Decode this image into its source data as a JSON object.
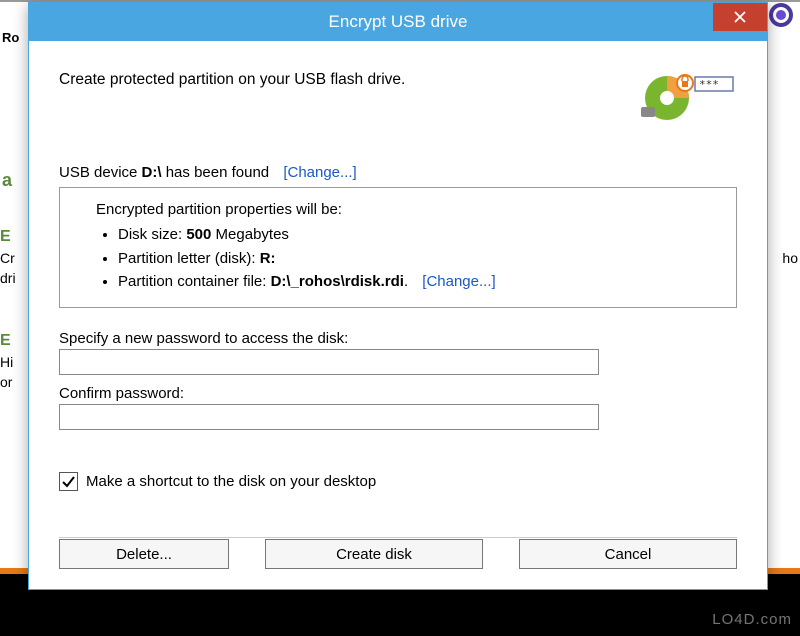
{
  "background": {
    "ro_label": "Ro",
    "left_text_partial_1": "E",
    "left_text_partial_2": "Cr",
    "left_text_partial_3": "dri",
    "left_text_partial_4": "E",
    "left_text_partial_5": "Hi",
    "left_text_partial_6": "or",
    "right_text_partial": "ho",
    "watermark": "LO4D.com"
  },
  "dialog": {
    "title": "Encrypt USB drive",
    "heading": "Create protected partition on your USB flash drive.",
    "device_prefix": "USB device ",
    "device_letter": "D:\\",
    "device_suffix": " has been found",
    "change_link": "[Change...]",
    "props": {
      "intro": "Encrypted partition properties will be:",
      "size_label": "Disk size: ",
      "size_value": "500",
      "size_unit": " Megabytes",
      "letter_label": "Partition letter (disk): ",
      "letter_value": "R:",
      "container_label": "Partition container file: ",
      "container_value": "D:\\_rohos\\rdisk.rdi",
      "container_dot": ".",
      "change2": "[Change...]"
    },
    "password_label": "Specify a new password to access the disk:",
    "confirm_label": "Confirm password:",
    "shortcut_checkbox": "Make a shortcut to the disk on your desktop",
    "buttons": {
      "delete": "Delete...",
      "create": "Create disk",
      "cancel": "Cancel"
    }
  }
}
